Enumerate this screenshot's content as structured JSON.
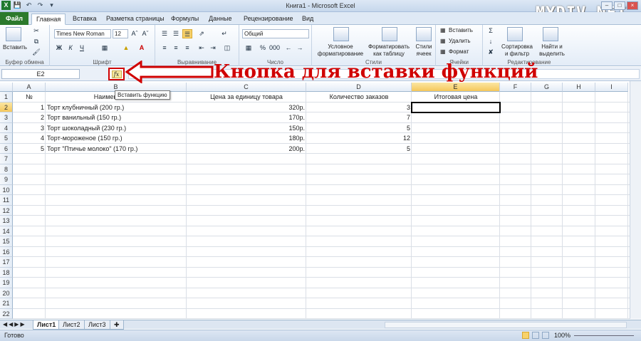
{
  "window": {
    "title": "Книга1  -  Microsoft Excel",
    "watermark": "MYDIV.NET"
  },
  "tabs": [
    "Файл",
    "Главная",
    "Вставка",
    "Разметка страницы",
    "Формулы",
    "Данные",
    "Рецензирование",
    "Вид"
  ],
  "ribbon": {
    "clipboard": {
      "paste": "Вставить",
      "label": "Буфер обмена"
    },
    "font": {
      "name": "Times New Roman",
      "size": "12",
      "bold": "Ж",
      "italic": "К",
      "underline": "Ч",
      "label": "Шрифт"
    },
    "alignment": {
      "label": "Выравнивание"
    },
    "number": {
      "format": "Общий",
      "label": "Число"
    },
    "styles": {
      "conditional": "Условное форматирование",
      "table": "Форматировать как таблицу",
      "cell_styles": "Стили ячеек",
      "label": "Стили"
    },
    "cells": {
      "insert": "Вставить",
      "delete": "Удалить",
      "format": "Формат",
      "label": "Ячейки"
    },
    "editing": {
      "sort": "Сортировка и фильтр",
      "find": "Найти и выделить",
      "label": "Редактирование"
    }
  },
  "formula_bar": {
    "name_box": "E2",
    "fx": "fx",
    "tooltip": "Вставить функцию",
    "callout": "Кнопка для вставки функций"
  },
  "columns": [
    "A",
    "B",
    "C",
    "D",
    "E",
    "F",
    "G",
    "H",
    "I"
  ],
  "rows": [
    "1",
    "2",
    "3",
    "4",
    "5",
    "6",
    "7",
    "8",
    "9",
    "10",
    "11",
    "12",
    "13",
    "14",
    "15",
    "16",
    "17",
    "18",
    "19",
    "20",
    "21",
    "22"
  ],
  "headers": {
    "a": "№",
    "b": "Наименование",
    "c": "Цена за единицу товара",
    "d": "Количество заказов",
    "e": "Итоговая цена"
  },
  "table": [
    {
      "n": "1",
      "name": "Торт клубничный (200 гр.)",
      "price": "320р.",
      "qty": "3"
    },
    {
      "n": "2",
      "name": "Торт ванильный (150 гр.)",
      "price": "170р.",
      "qty": "7"
    },
    {
      "n": "3",
      "name": "Торт шоколадный (230 гр.)",
      "price": "150р.",
      "qty": "5"
    },
    {
      "n": "4",
      "name": "Торт-мороженое (150 гр.)",
      "price": "180р.",
      "qty": "12"
    },
    {
      "n": "5",
      "name": "Торт \"Птичье молоко\" (170 гр.)",
      "price": "200р.",
      "qty": "5"
    }
  ],
  "sheets": [
    "Лист1",
    "Лист2",
    "Лист3"
  ],
  "status": {
    "ready": "Готово",
    "zoom": "100%"
  }
}
